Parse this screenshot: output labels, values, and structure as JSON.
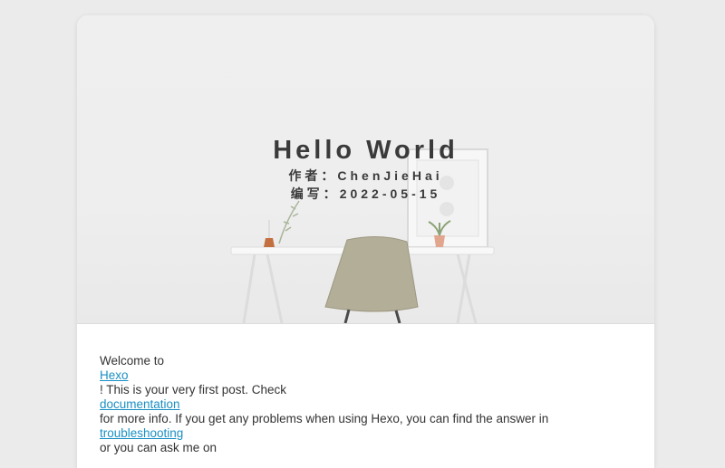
{
  "post": {
    "title": "Hello World",
    "author_label": "作者：",
    "author": "ChenJieHai",
    "date_label": "编写：",
    "date": "2022-05-15"
  },
  "content": {
    "line1": "Welcome to",
    "link_hexo": "Hexo",
    "line2": "! This is your very first post. Check",
    "link_docs": "documentation",
    "line3": "for more info. If you get any problems when using Hexo, you can find the answer in",
    "link_troubleshooting": "troubleshooting",
    "line4": "or you can ask me on"
  },
  "colors": {
    "background": "#ebebeb",
    "card": "#ffffff",
    "title_text": "#3a3a3a",
    "link": "#1a8fc4"
  }
}
